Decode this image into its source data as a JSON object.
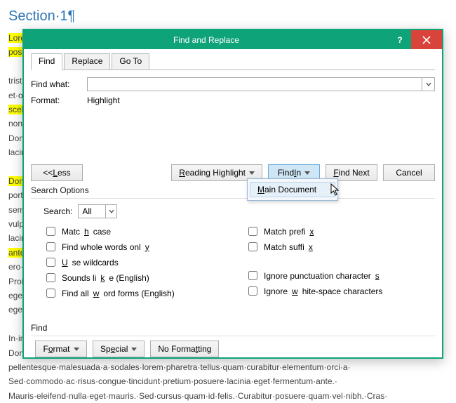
{
  "document": {
    "section_title": "Section·1¶",
    "lines": [
      "Lorem·ipsum·dolor·sit·amet,·consectetur·adipiscing·elit.·Aliquam·sagittis·nunc·nec·nulla·",
      "posuere,·at·convallis·justo·congue.·Morbi·libero·quam,·imperdiet·eu·tincidunt·id,·",
      "",
      "tristique·consequat·elit.·In·placerat·vitae·purus·in·scelerisque.·Suspendisse·eget·mauris·",
      "et·odio·viverra·volutpat·vitae·eu·ante.·Fusce·luctus·dapibus·nulla·id·ornare.·Etiam·ut·",
      "scelerisque·mauris.·Etiam·venenatis·nunc·facilisis·pharetra·efficitur.·",
      "non·rhoncus·ligula·volutpat.·Mauris·libero·augue,·elementum·quis·aliquet·sit·amet·nulla.·",
      "Donec·pellentesque·fermentum·sem·id·imperdiet·quam·bibendum·quis·sapien·nibh·lectus,·in·",
      "lacinia·enim·nec·magna·mollis·dapibus.¶",
      "",
      "Donec·cursus·purus·quis·ultricies·congue.·Pellentesque·faucibus·leo·sit·amet·nunc·",
      "porta,·in·sagittis·suscipit·maximus.·Morbi·porta·lectus·eu·neque·bibendum·ornare.·Donec·",
      "semper·ornare·lorem·sed·ultrices·consectetur·non·eget·pulvinar·sed·urna.·Suspendisse·",
      "vulputate·nulla·a·arcu·pharetra·facilisis.·Nullam·auctor·dapibus·est·eu·ultricies·velit·",
      "lacinia·at·elementum·pellentesque·arcu·sit·amet·pharetra·tellus·ultrices·nec·varius·vel·",
      "ante,·et·mollis·tellus·ornare·at·fringilla·mauris·at·tempor·ultrices·sit·amet·nec·ac·",
      "ero·",
      "Proin·ante·nulla·cursus·sagittis·arcu·in·blandit·purus·feugiat·placerat·orci·eget·",
      "egestas·pulvinar·sodales·lectus·eget·tempor·rhoncus·diam·quam·suscipit·tempus·nec·ac·",
      "eget·sem·fringilla·tortor·id·semper·neque.¶",
      "",
      "In·in·dolor·purus·sed·ornare·auctor·mi·in·vestibulum·metus·facilisis·rhoncus·mollis.·",
      "Donec·a·nulla·vel·turpis·tempor·malesuada·nisi·commodo·eu·quam·consequat·dignissim·",
      "pellentesque·malesuada·a·sodales·lorem·pharetra·tellus·quam·curabitur·elementum·orci·a·",
      "Sed·commodo·ac·risus·congue·tincidunt·pretium·posuere·lacinia·eget·fermentum·ante.·",
      "Mauris·eleifend·nulla·eget·mauris.·Sed·cursus·quam·id·felis.·Curabitur·posuere·quam·vel·nibh.·Cras·"
    ],
    "highlighted_prefix_lines": [
      0,
      1,
      5,
      10,
      15
    ]
  },
  "dialog": {
    "title": "Find and Replace",
    "tabs": {
      "find": "Find",
      "replace": "Replace",
      "goto": "Go To"
    },
    "findwhat_label": "Find what:",
    "findwhat_value": "",
    "format_label": "Format:",
    "format_value": "Highlight",
    "buttons": {
      "less": "<< Less",
      "reading_highlight": "Reading Highlight",
      "find_in": "Find In",
      "find_next": "Find Next",
      "cancel": "Cancel",
      "format": "Format",
      "special": "Special",
      "no_formatting": "No Formatting"
    },
    "search_options_label": "Search Options",
    "search_label": "Search:",
    "search_value": "All",
    "checks_left": [
      {
        "u": "H",
        "rest": "atch case",
        "pre": "M"
      },
      {
        "u": "Y",
        "rest": "ind whole words onl",
        "pre": "F",
        "suf": ""
      },
      {
        "u": "U",
        "rest": "se wildcards",
        "pre": ""
      },
      {
        "u": "",
        "rest": "Sounds like (English)",
        "pre": ""
      },
      {
        "u": "",
        "rest": "Find all word forms (English)",
        "pre": ""
      }
    ],
    "find_footer_label": "Find",
    "popup": {
      "main_document": "Main Document"
    },
    "cb": {
      "match_case": "Match case",
      "whole_words": "Find whole words only",
      "wildcards": "Use wildcards",
      "sounds_like": "Sounds like (English)",
      "word_forms": "Find all word forms (English)",
      "match_prefix": "Match prefix",
      "match_suffix": "Match suffix",
      "ignore_punct": "Ignore punctuation characters",
      "ignore_ws": "Ignore white-space characters"
    }
  }
}
